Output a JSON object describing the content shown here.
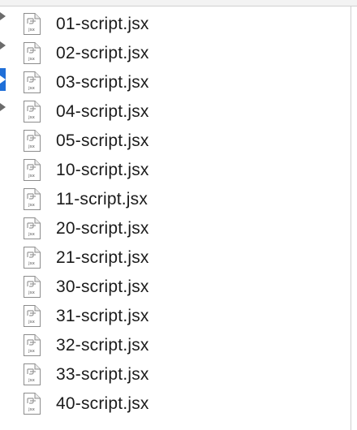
{
  "file_list": {
    "items": [
      {
        "name": "01-script.jsx",
        "icon": "jsx-file-icon"
      },
      {
        "name": "02-script.jsx",
        "icon": "jsx-file-icon"
      },
      {
        "name": "03-script.jsx",
        "icon": "jsx-file-icon"
      },
      {
        "name": "04-script.jsx",
        "icon": "jsx-file-icon"
      },
      {
        "name": "05-script.jsx",
        "icon": "jsx-file-icon"
      },
      {
        "name": "10-script.jsx",
        "icon": "jsx-file-icon"
      },
      {
        "name": "11-script.jsx",
        "icon": "jsx-file-icon"
      },
      {
        "name": "20-script.jsx",
        "icon": "jsx-file-icon"
      },
      {
        "name": "21-script.jsx",
        "icon": "jsx-file-icon"
      },
      {
        "name": "30-script.jsx",
        "icon": "jsx-file-icon"
      },
      {
        "name": "31-script.jsx",
        "icon": "jsx-file-icon"
      },
      {
        "name": "32-script.jsx",
        "icon": "jsx-file-icon"
      },
      {
        "name": "33-script.jsx",
        "icon": "jsx-file-icon"
      },
      {
        "name": "40-script.jsx",
        "icon": "jsx-file-icon"
      }
    ],
    "icon_caption": "jsx"
  },
  "left_gutter": {
    "disclosure_icon": "disclosure-triangle-icon",
    "selected_color": "#1f6fd8"
  },
  "colors": {
    "background": "#ffffff",
    "text": "#1c1c1c",
    "selection": "#1f6fd8"
  }
}
